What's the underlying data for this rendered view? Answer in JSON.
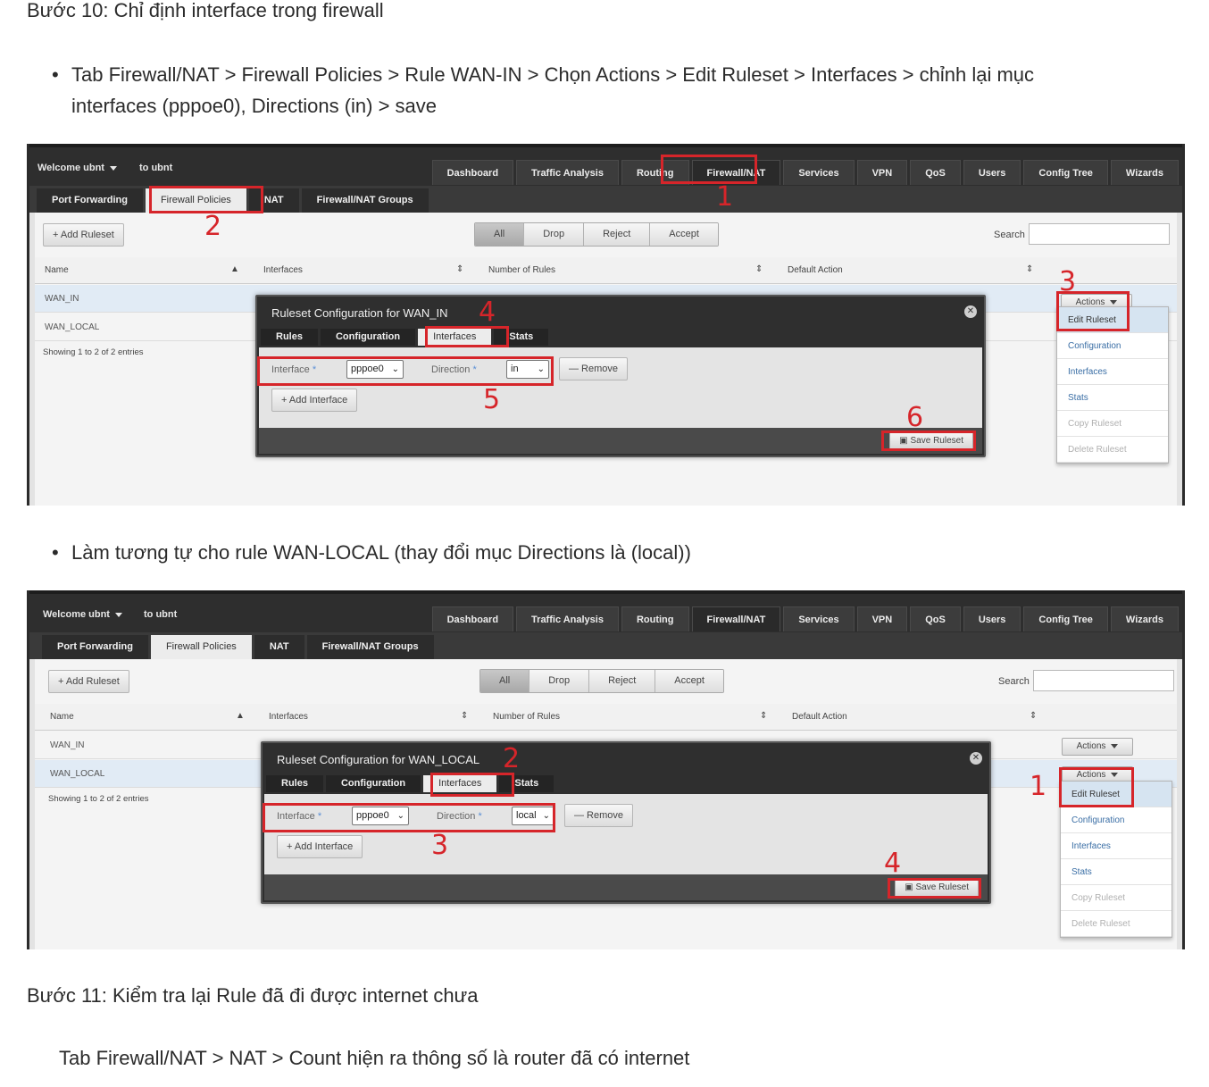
{
  "step10_title": "Bước 10: Chỉ định interface trong firewall",
  "bullet1_line1": "Tab Firewall/NAT > Firewall Policies > Rule WAN-IN > Chọn Actions > Edit Ruleset > Interfaces > chỉnh lại mục",
  "bullet1_line2": "interfaces (pppoe0), Directions (in) > save",
  "bullet2": "Làm tương tự cho rule WAN-LOCAL (thay đổi mục Directions là (local))",
  "step11_title": "Bước 11: Kiểm tra lại Rule đã đi được internet chưa",
  "step11_text": "Tab Firewall/NAT > NAT > Count hiện ra thông số là router đã có internet",
  "bullet_glyph": "•",
  "ui": {
    "welcome": "Welcome ubnt",
    "to_ubnt": "to ubnt",
    "nav": [
      "Dashboard",
      "Traffic Analysis",
      "Routing",
      "Firewall/NAT",
      "Services",
      "VPN",
      "QoS",
      "Users",
      "Config Tree",
      "Wizards"
    ],
    "subtabs": [
      "Port Forwarding",
      "Firewall Policies",
      "NAT",
      "Firewall/NAT Groups"
    ],
    "add_ruleset": "+ Add Ruleset",
    "filters": [
      "All",
      "Drop",
      "Reject",
      "Accept"
    ],
    "search_label": "Search",
    "columns": [
      "Name",
      "Interfaces",
      "Number of Rules",
      "Default Action"
    ],
    "rows": [
      "WAN_IN",
      "WAN_LOCAL"
    ],
    "showing": "Showing 1 to 2 of 2 entries",
    "actions": "Actions",
    "menu": [
      "Edit Ruleset",
      "Configuration",
      "Interfaces",
      "Stats",
      "Copy Ruleset",
      "Delete Ruleset"
    ],
    "dialog_tabs": [
      "Rules",
      "Configuration",
      "Interfaces",
      "Stats"
    ],
    "interface_label": "Interface",
    "interface_value": "pppoe0",
    "direction_label": "Direction",
    "remove": "— Remove",
    "add_interface": "+ Add Interface",
    "save_ruleset": "Save Ruleset",
    "sort_up": "▲",
    "sort_both": "⇕",
    "close_glyph": "✕",
    "chevron": "⌄",
    "save_icon": "▣",
    "star": "*"
  },
  "shot1": {
    "dialog_title": "Ruleset Configuration for WAN_IN",
    "direction_value": "in",
    "markers": [
      "1",
      "2",
      "3",
      "4",
      "5",
      "6"
    ]
  },
  "shot2": {
    "dialog_title": "Ruleset Configuration for WAN_LOCAL",
    "direction_value": "local",
    "markers": [
      "1",
      "2",
      "3",
      "4"
    ]
  },
  "colors": {
    "annotation_red": "#d6252a",
    "nav_dark": "#2e2e2e",
    "link_blue": "#3a6ea5"
  }
}
